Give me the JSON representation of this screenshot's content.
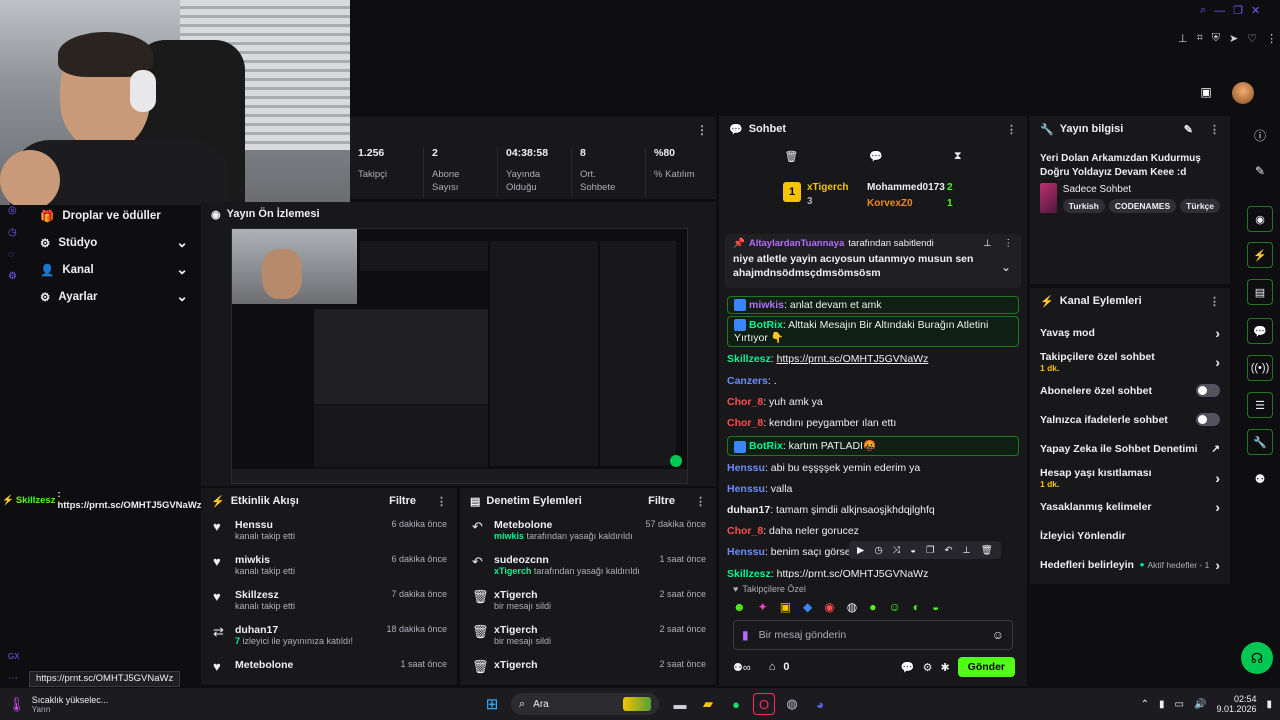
{
  "stats": [
    {
      "value": "1.256",
      "label": "Takipçi"
    },
    {
      "value": "2",
      "label": "Abone Sayısı"
    },
    {
      "value": "04:38:58",
      "label": "Yayında Olduğu"
    },
    {
      "value": "8",
      "label": "Ort. Sohbete"
    },
    {
      "value": "%80",
      "label": "% Katılım"
    }
  ],
  "left_nav": [
    {
      "label": "Droplar ve ödüller",
      "icon": "gift-icon"
    },
    {
      "label": "Stüdyo",
      "icon": "gear-icon"
    },
    {
      "label": "Kanal",
      "icon": "person-icon"
    },
    {
      "label": "Ayarlar",
      "icon": "gear-icon"
    }
  ],
  "preview": {
    "title": "Yayın Ön İzlemesi"
  },
  "chat_ticker": {
    "nick": "Skillzesz",
    "text": ": https://prnt.sc/OMHTJ5GVNaWz"
  },
  "activity": {
    "title": "Etkinlik Akışı",
    "filter": "Filtre",
    "items": [
      {
        "name": "Henssu",
        "sub": "kanalı takip etti",
        "time": "6 dakika önce",
        "icon": "heart-icon"
      },
      {
        "name": "miwkis",
        "sub": "kanalı takip etti",
        "time": "6 dakika önce",
        "icon": "heart-icon"
      },
      {
        "name": "Skillzesz",
        "sub": "kanalı takip etti",
        "time": "7 dakika önce",
        "icon": "heart-icon"
      },
      {
        "name": "duhan17",
        "sub_pre": "7",
        "sub": " izleyici ile yayınınıza katıldı!",
        "time": "18 dakika önce",
        "icon": "raid-icon"
      },
      {
        "name": "Metebolone",
        "sub": "",
        "time": "1 saat önce",
        "icon": "heart-icon"
      }
    ]
  },
  "moderation": {
    "title": "Denetim Eylemleri",
    "filter": "Filtre",
    "items": [
      {
        "name": "Metebolone",
        "actor": "miwkis",
        "sub": " tarafından yasağı kaldırıldı",
        "time": "57 dakika önce",
        "icon": "undo-icon"
      },
      {
        "name": "sudeozcnn",
        "actor": "xTigerch",
        "sub": " tarafından yasağı kaldırıldı",
        "time": "1 saat önce",
        "icon": "undo-icon"
      },
      {
        "name": "xTigerch",
        "actor": "",
        "sub": "bir mesajı sildi",
        "time": "2 saat önce",
        "icon": "trash-icon"
      },
      {
        "name": "xTigerch",
        "actor": "",
        "sub": "bir mesajı sildi",
        "time": "2 saat önce",
        "icon": "trash-icon"
      },
      {
        "name": "xTigerch",
        "actor": "",
        "sub": "",
        "time": "2 saat önce",
        "icon": "trash-icon"
      }
    ]
  },
  "chat": {
    "title": "Sohbet",
    "top": [
      {
        "rank": "1",
        "name": "xTigerch",
        "count": "3"
      },
      {
        "name": "Mohammed0173",
        "count": "2"
      },
      {
        "name": "KorvexZ0",
        "count": "1"
      }
    ],
    "pinned": {
      "by": "AltaylardanTuannaya",
      "by_suffix": " tarafından sabitlendi",
      "text": "niye atletle yayin acıyosun utanmıyo musun sen ahajmdnsödmsçdmsömsösm"
    },
    "messages": [
      {
        "nick": "miwkis",
        "color": "#b46cff",
        "text": ": anlat devam et amk",
        "hl": true
      },
      {
        "nick": "BotRix",
        "color": "#00f593",
        "text": ": Alttaki Mesajın Bir Altındaki Burağın Atletini Yırtıyor 👇",
        "hl": true
      },
      {
        "nick": "Skillzesz",
        "color": "#00f593",
        "text": ": ",
        "link": "https://prnt.sc/OMHTJ5GVNaWz"
      },
      {
        "nick": "Canzers",
        "color": "#6b8cff",
        "text": ": ."
      },
      {
        "nick": "Chor_8",
        "color": "#ff4d4d",
        "text": ": yuh amk ya"
      },
      {
        "nick": "Chor_8",
        "color": "#ff4d4d",
        "text": ": kendını peygamber ılan ettı"
      },
      {
        "nick": "BotRix",
        "color": "#00f593",
        "text": ": kartım PATLADI🤬",
        "hl": true
      },
      {
        "nick": "Henssu",
        "color": "#6b8cff",
        "text": ": abi bu eşşşşek yemin ederim ya"
      },
      {
        "nick": "Henssu",
        "color": "#6b8cff",
        "text": ": valla"
      },
      {
        "nick": "duhan17",
        "color": "#efeff1",
        "text": ": tamam şimdii alkjnsaoşjkhdqjlghfq"
      },
      {
        "nick": "Chor_8",
        "color": "#ff4d4d",
        "text": ": daha neler gorucez"
      },
      {
        "nick": "Henssu",
        "color": "#6b8cff",
        "text": ": benim saçı görsen"
      },
      {
        "nick": "Skillzesz",
        "color": "#00f593",
        "text": ": ",
        "link": "https://prnt.sc/OMHTJ5GVNaWz"
      }
    ],
    "emote_label": "Takipçilere Özel",
    "input_placeholder": "Bir mesaj gönderin",
    "points": "0",
    "send": "Gönder"
  },
  "stream_info": {
    "title": "Yayın bilgisi",
    "stream_title": "Yeri Dolan Arkamızdan Kudurmuş Doğru Yoldayız Devam Keee :d",
    "category": "Sadece Sohbet",
    "tags": [
      "Turkish",
      "CODENAMES",
      "Türkçe"
    ]
  },
  "channel_actions": {
    "title": "Kanal Eylemleri",
    "items": [
      {
        "label": "Yavaş mod",
        "kind": "chevron"
      },
      {
        "label": "Takipçilere özel sohbet",
        "sub": "1 dk.",
        "kind": "chevron"
      },
      {
        "label": "Abonelere özel sohbet",
        "kind": "toggle"
      },
      {
        "label": "Yalnızca ifadelerle sohbet",
        "kind": "toggle"
      },
      {
        "label": "Yapay Zeka ile Sohbet Denetimi",
        "kind": "external"
      },
      {
        "label": "Hesap yaşı kısıtlaması",
        "sub": "1 dk.",
        "kind": "chevron"
      },
      {
        "label": "Yasaklanmış kelimeler",
        "kind": "chevron"
      },
      {
        "label": "İzleyici Yönlendir",
        "kind": "none"
      },
      {
        "label": "Hedefleri belirleyin",
        "kind": "goal",
        "extra": "Aktif hedefler - 1"
      }
    ]
  },
  "url_tooltip": "https://prnt.sc/OMHTJ5GVNaWz",
  "gx_label": "GX",
  "taskbar": {
    "weather_title": "Sıcaklık yükselec...",
    "weather_sub": "Yarın",
    "search": "Ara",
    "time": "02:54",
    "date": "9.01.2026"
  },
  "colors": {
    "accent": "#53fc18",
    "bg": "#0e0e10",
    "panel": "#18181b"
  }
}
